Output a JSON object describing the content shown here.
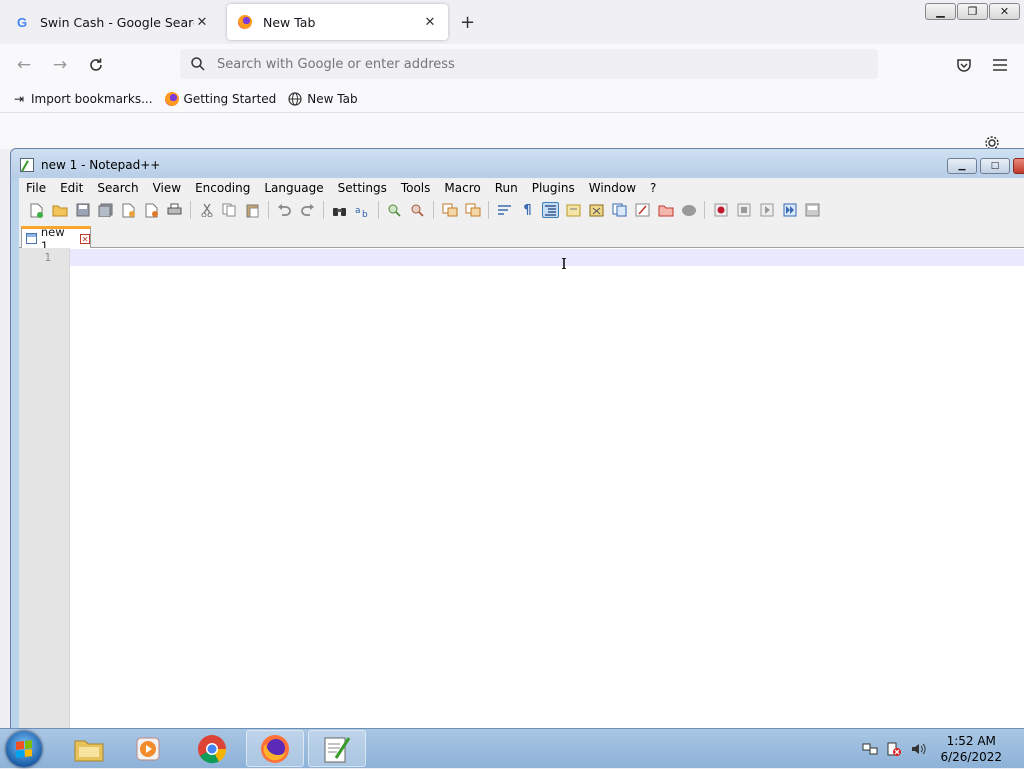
{
  "firefox": {
    "tabs": [
      {
        "title": "Swin Cash - Google Search",
        "favicon": "google-icon",
        "active": false
      },
      {
        "title": "New Tab",
        "favicon": "firefox-icon",
        "active": true
      }
    ],
    "new_tab_glyph": "+",
    "urlbar": {
      "placeholder": "Search with Google or enter address",
      "value": ""
    },
    "bookmarks": [
      {
        "label": "Import bookmarks...",
        "icon": "import-icon"
      },
      {
        "label": "Getting Started",
        "icon": "firefox-icon"
      },
      {
        "label": "New Tab",
        "icon": "globe-icon"
      }
    ]
  },
  "notepad": {
    "title": "new 1 - Notepad++",
    "menu": [
      "File",
      "Edit",
      "Search",
      "View",
      "Encoding",
      "Language",
      "Settings",
      "Tools",
      "Macro",
      "Run",
      "Plugins",
      "Window",
      "?"
    ],
    "tab": {
      "label": "new 1"
    },
    "editor": {
      "line_numbers": [
        "1"
      ],
      "content": ""
    }
  },
  "taskbar": {
    "pinned": [
      "explorer-icon",
      "media-player-icon",
      "chrome-icon",
      "firefox-icon",
      "notepadpp-icon"
    ],
    "clock": {
      "time": "1:52 AM",
      "date": "6/26/2022"
    }
  },
  "colors": {
    "accent": "#fba52b",
    "taskbar": "#a9c6e3",
    "current_line": "#e8e8ff"
  }
}
